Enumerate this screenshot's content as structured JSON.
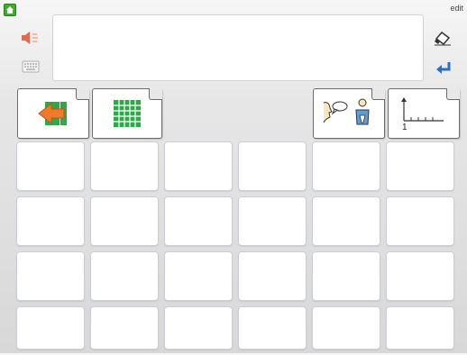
{
  "toolbar": {
    "edit_label": "edit"
  },
  "icons": {
    "home": "home-icon",
    "speaker": "speaker-muted-icon",
    "keyboard": "keyboard-icon",
    "eraser": "eraser-icon",
    "enter": "enter-icon",
    "back": "back-arrow-icon",
    "grid": "grid-icon",
    "talk": "talk-icon",
    "numberline": "number-line-icon"
  },
  "numberline": {
    "label": "1"
  },
  "colors": {
    "home_green": "#3fae2a",
    "back_green": "#2fa84a",
    "back_orange": "#f07a2a",
    "grid_green": "#2fa84a",
    "enter_blue": "#2a6fc9",
    "speaker_red": "#e06a50"
  },
  "grid": {
    "rows": 4,
    "columns": 6
  }
}
